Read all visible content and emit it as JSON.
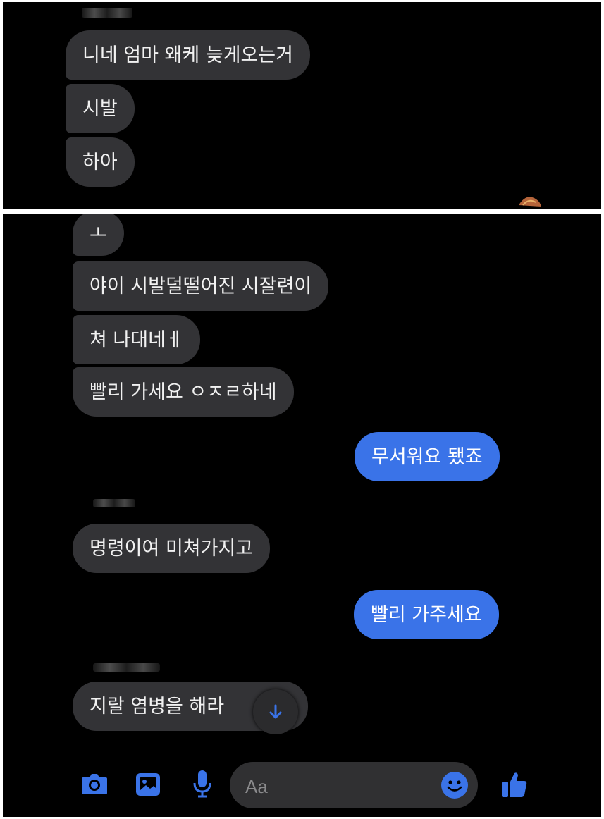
{
  "top_panel": {
    "messages": [
      {
        "text": "니네 엄마 왜케 늦게오는거"
      },
      {
        "text": "시발"
      },
      {
        "text": "하아"
      }
    ]
  },
  "bottom_panel": {
    "received_group_1": [
      {
        "text": "ㅗ"
      },
      {
        "text": "야이 시발덜떨어진 시잘련이"
      },
      {
        "text": "쳐 나대네ㅔ"
      },
      {
        "text": "빨리 가세요 ㅇㅈㄹ하네"
      }
    ],
    "sent_1": {
      "text": "무서워요 됐죠"
    },
    "received_2": {
      "text": "명령이여 미쳐가지고"
    },
    "sent_2": {
      "text": "빨리 가주세요"
    },
    "received_3": {
      "text": "지랄 염병을 해라"
    }
  },
  "composer": {
    "placeholder": "Aa",
    "icons": [
      "camera-icon",
      "gallery-icon",
      "microphone-icon",
      "emoji-icon",
      "thumbs-up-icon"
    ]
  },
  "colors": {
    "background": "#000000",
    "received_bubble": "#333336",
    "sent_bubble": "#3a73e8",
    "accent": "#3a73e8"
  }
}
